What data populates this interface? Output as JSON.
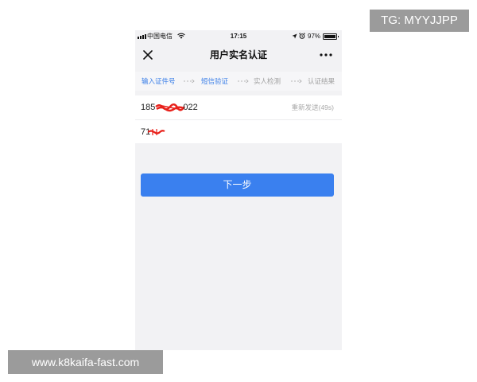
{
  "status_bar": {
    "carrier": "中国电信",
    "time": "17:15",
    "battery_percent": "97%",
    "battery_level": 0.97,
    "icons": [
      "signal-icon",
      "wifi-icon",
      "location-icon",
      "alarm-icon",
      "battery-icon"
    ]
  },
  "nav": {
    "title": "用户实名认证",
    "left_icon": "close-icon",
    "right_icon": "more-icon"
  },
  "steps": [
    {
      "label": "输入证件号",
      "highlighted": true
    },
    {
      "label": "短信验证",
      "highlighted": true
    },
    {
      "label": "实人检测",
      "highlighted": false
    },
    {
      "label": "认证结果",
      "highlighted": false
    }
  ],
  "step_separator_icon": "dotted-arrow-icon",
  "form": {
    "phone": {
      "visible_start": "185",
      "visible_end": "022",
      "redacted": true
    },
    "resend_label": "重新发送(49s)",
    "code": {
      "visible_start": "71",
      "redacted": true
    }
  },
  "next_button": {
    "label": "下一步"
  },
  "watermarks": {
    "top_right": "TG: MYYJJPP",
    "bottom_left": "www.k8kaifa-fast.com"
  },
  "colors": {
    "accent": "#3a80ef",
    "step_active": "#3b7fe8",
    "step_inactive": "#a0a0a0",
    "redaction": "#e8211b",
    "screen_bg": "#f2f2f4",
    "watermark_bg": "#9b9b9b"
  }
}
